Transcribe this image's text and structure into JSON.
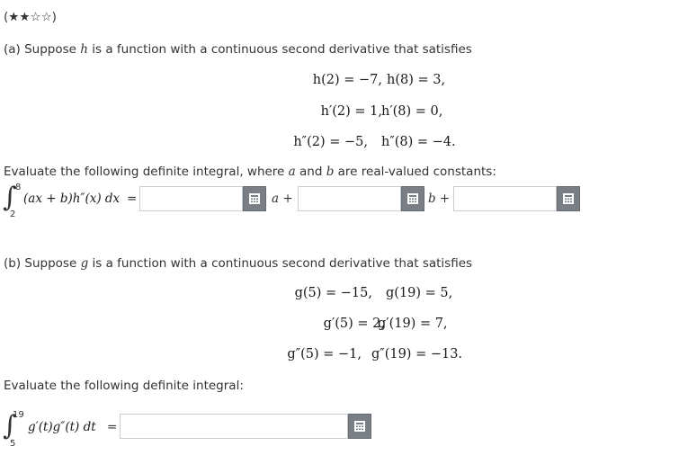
{
  "difficulty": "(★★☆☆)",
  "part_a": {
    "intro_prefix": "(a) Suppose ",
    "intro_var": "h",
    "intro_suffix": " is a function with a continuous second derivative that satisfies",
    "conditions": [
      [
        "h(2) = −7,",
        "h(8) = 3,"
      ],
      [
        "h′(2) = 1,",
        "h′(8) = 0,"
      ],
      [
        "h″(2) = −5,",
        "h″(8) = −4."
      ]
    ],
    "evaluate_prefix": "Evaluate the following definite integral, where ",
    "evaluate_var_a": "a",
    "evaluate_mid": " and ",
    "evaluate_var_b": "b",
    "evaluate_suffix": " are real-valued constants:",
    "integral_upper": "8",
    "integral_lower": "2",
    "integrand": "(ax + b)h″(x) dx",
    "equals": "=",
    "term_a": "a +",
    "term_b": "b +",
    "answer1": "",
    "answer2": "",
    "answer3": ""
  },
  "part_b": {
    "intro_prefix": "(b) Suppose ",
    "intro_var": "g",
    "intro_suffix": " is a function with a continuous second derivative that satisfies",
    "conditions": [
      [
        "g(5) = −15,",
        "g(19) = 5,"
      ],
      [
        "g′(5) = 2,",
        "g′(19) = 7,"
      ],
      [
        "g″(5) = −1,",
        "g″(19) = −13."
      ]
    ],
    "evaluate_text": "Evaluate the following definite integral:",
    "integral_upper": "19",
    "integral_lower": "5",
    "integrand": "g′(t)g″(t) dt",
    "equals": "=",
    "answer": ""
  },
  "icons": {
    "calculator": "calculator-icon"
  },
  "colors": {
    "button_bg": "#7a7f86",
    "input_border": "#c9ccd1",
    "text": "#333333"
  }
}
